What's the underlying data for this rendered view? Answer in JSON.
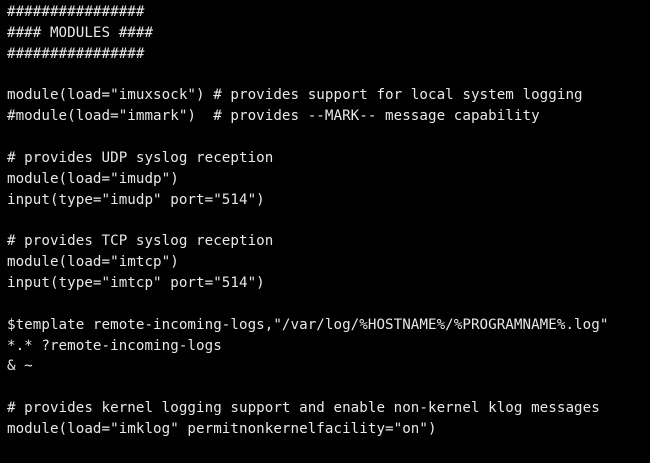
{
  "terminal": {
    "text_color": "#e8e8e8",
    "background": "#000000",
    "lines": [
      "################",
      "#### MODULES ####",
      "################",
      "",
      "module(load=\"imuxsock\") # provides support for local system logging",
      "#module(load=\"immark\")  # provides --MARK-- message capability",
      "",
      "# provides UDP syslog reception",
      "module(load=\"imudp\")",
      "input(type=\"imudp\" port=\"514\")",
      "",
      "# provides TCP syslog reception",
      "module(load=\"imtcp\")",
      "input(type=\"imtcp\" port=\"514\")",
      "",
      "$template remote-incoming-logs,\"/var/log/%HOSTNAME%/%PROGRAMNAME%.log\"",
      "*.* ?remote-incoming-logs",
      "& ~",
      "",
      "# provides kernel logging support and enable non-kernel klog messages",
      "module(load=\"imklog\" permitnonkernelfacility=\"on\")"
    ]
  }
}
